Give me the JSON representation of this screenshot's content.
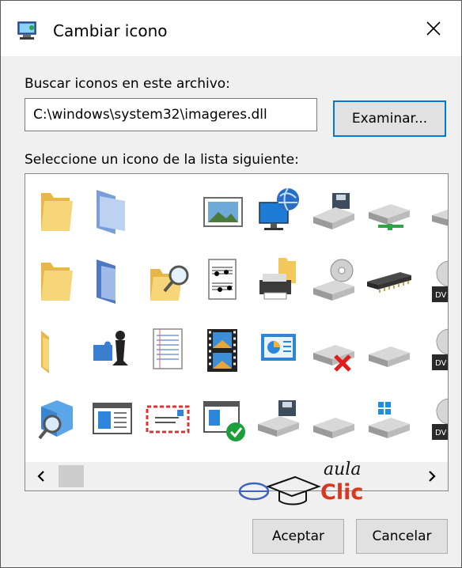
{
  "dialog": {
    "title": "Cambiar icono",
    "title_icon": "computer-monitor-icon",
    "close_icon": "close-icon"
  },
  "file_section": {
    "label": "Buscar iconos en este archivo:",
    "path_value": "C:\\windows\\system32\\imageres.dll",
    "browse_label": "Examinar..."
  },
  "list_section": {
    "label": "Seleccione un icono de la lista siguiente:",
    "icons": [
      [
        "folder-icon",
        "folder-open-blue-icon",
        "blank-icon",
        "picture-frame-icon",
        "network-globe-monitor-icon",
        "floppy-drive-icon",
        "network-drive-icon",
        "drive-icon"
      ],
      [
        "folder-icon",
        "folder-open-blue-icon",
        "folder-search-icon",
        "music-sheet-icon",
        "printer-folder-icon",
        "cd-drive-icon",
        "memory-chip-icon",
        "dvd-drive-icon"
      ],
      [
        "folder-icon",
        "puzzle-chess-icon",
        "notepad-icon",
        "film-strip-icon",
        "control-panel-icon",
        "drive-error-icon",
        "drive-icon",
        "dvd-drive-icon"
      ],
      [
        "search-cube-icon",
        "window-app-icon",
        "mail-envelope-icon",
        "window-check-icon",
        "floppy-drive-icon",
        "drive-icon",
        "windows-drive-icon",
        "dvd-drive-icon"
      ]
    ],
    "scroll_left_icon": "chevron-left-icon",
    "scroll_right_icon": "chevron-right-icon"
  },
  "watermark": {
    "line1": "aula",
    "line2": "Clic"
  },
  "buttons": {
    "ok_label": "Aceptar",
    "cancel_label": "Cancelar"
  },
  "colors": {
    "focus_border": "#0078d7",
    "watermark_red": "#d9381e"
  }
}
